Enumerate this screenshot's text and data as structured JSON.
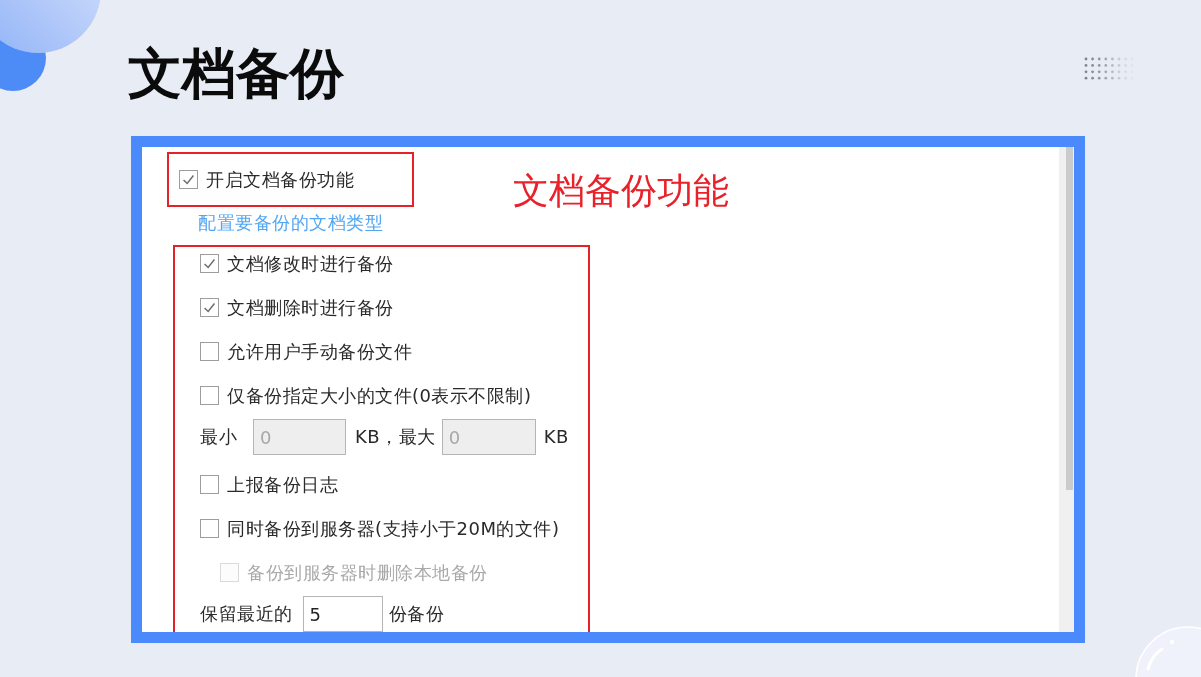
{
  "title": "文档备份",
  "screenshot": {
    "enable_option": {
      "label": "开启文档备份功能",
      "checked": true
    },
    "annotation": "文档备份功能",
    "config_link": "配置要备份的文档类型",
    "options": [
      {
        "kind": "checkbox",
        "label": "文档修改时进行备份",
        "checked": true,
        "disabled": false
      },
      {
        "kind": "checkbox",
        "label": "文档删除时进行备份",
        "checked": true,
        "disabled": false
      },
      {
        "kind": "checkbox",
        "label": "允许用户手动备份文件",
        "checked": false,
        "disabled": false
      },
      {
        "kind": "checkbox",
        "label": "仅备份指定大小的文件(0表示不限制)",
        "checked": false,
        "disabled": false
      },
      {
        "kind": "size_range",
        "min_label": "最小",
        "min_value": "0",
        "max_label": "KB，最大",
        "max_value": "0",
        "unit": "KB",
        "disabled": true
      },
      {
        "kind": "checkbox",
        "label": "上报备份日志",
        "checked": false,
        "disabled": false
      },
      {
        "kind": "checkbox",
        "label": "同时备份到服务器(支持小于20M的文件)",
        "checked": false,
        "disabled": false,
        "children": [
          {
            "kind": "checkbox",
            "label": "备份到服务器时删除本地备份",
            "checked": false,
            "disabled": true
          }
        ]
      },
      {
        "kind": "count",
        "label": "保留最近的",
        "value": "5",
        "unit": "份备份"
      }
    ]
  }
}
